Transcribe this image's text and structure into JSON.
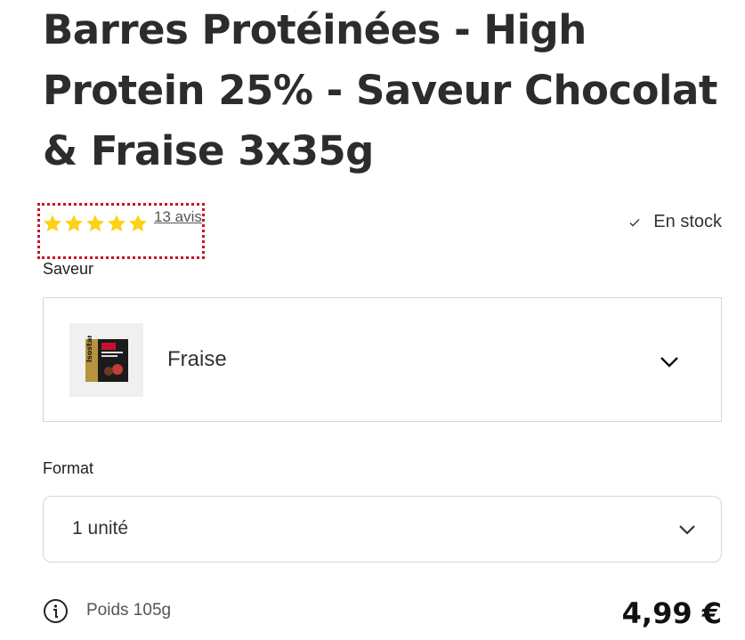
{
  "product": {
    "title": "Barres Protéinées - High Protein 25% - Saveur Chocolat & Fraise 3x35g",
    "rating": 5,
    "rating_max": 5,
    "reviews_label": "13 avis",
    "stock_label": "En stock",
    "price": "4,99 €",
    "weight": "Poids 105g"
  },
  "flavor": {
    "label": "Saveur",
    "selected": "Fraise"
  },
  "format": {
    "label": "Format",
    "selected": "1 unité"
  },
  "colors": {
    "star": "#fdd116",
    "highlight_border": "#c8102e",
    "text_dark": "#2c2c2c"
  }
}
